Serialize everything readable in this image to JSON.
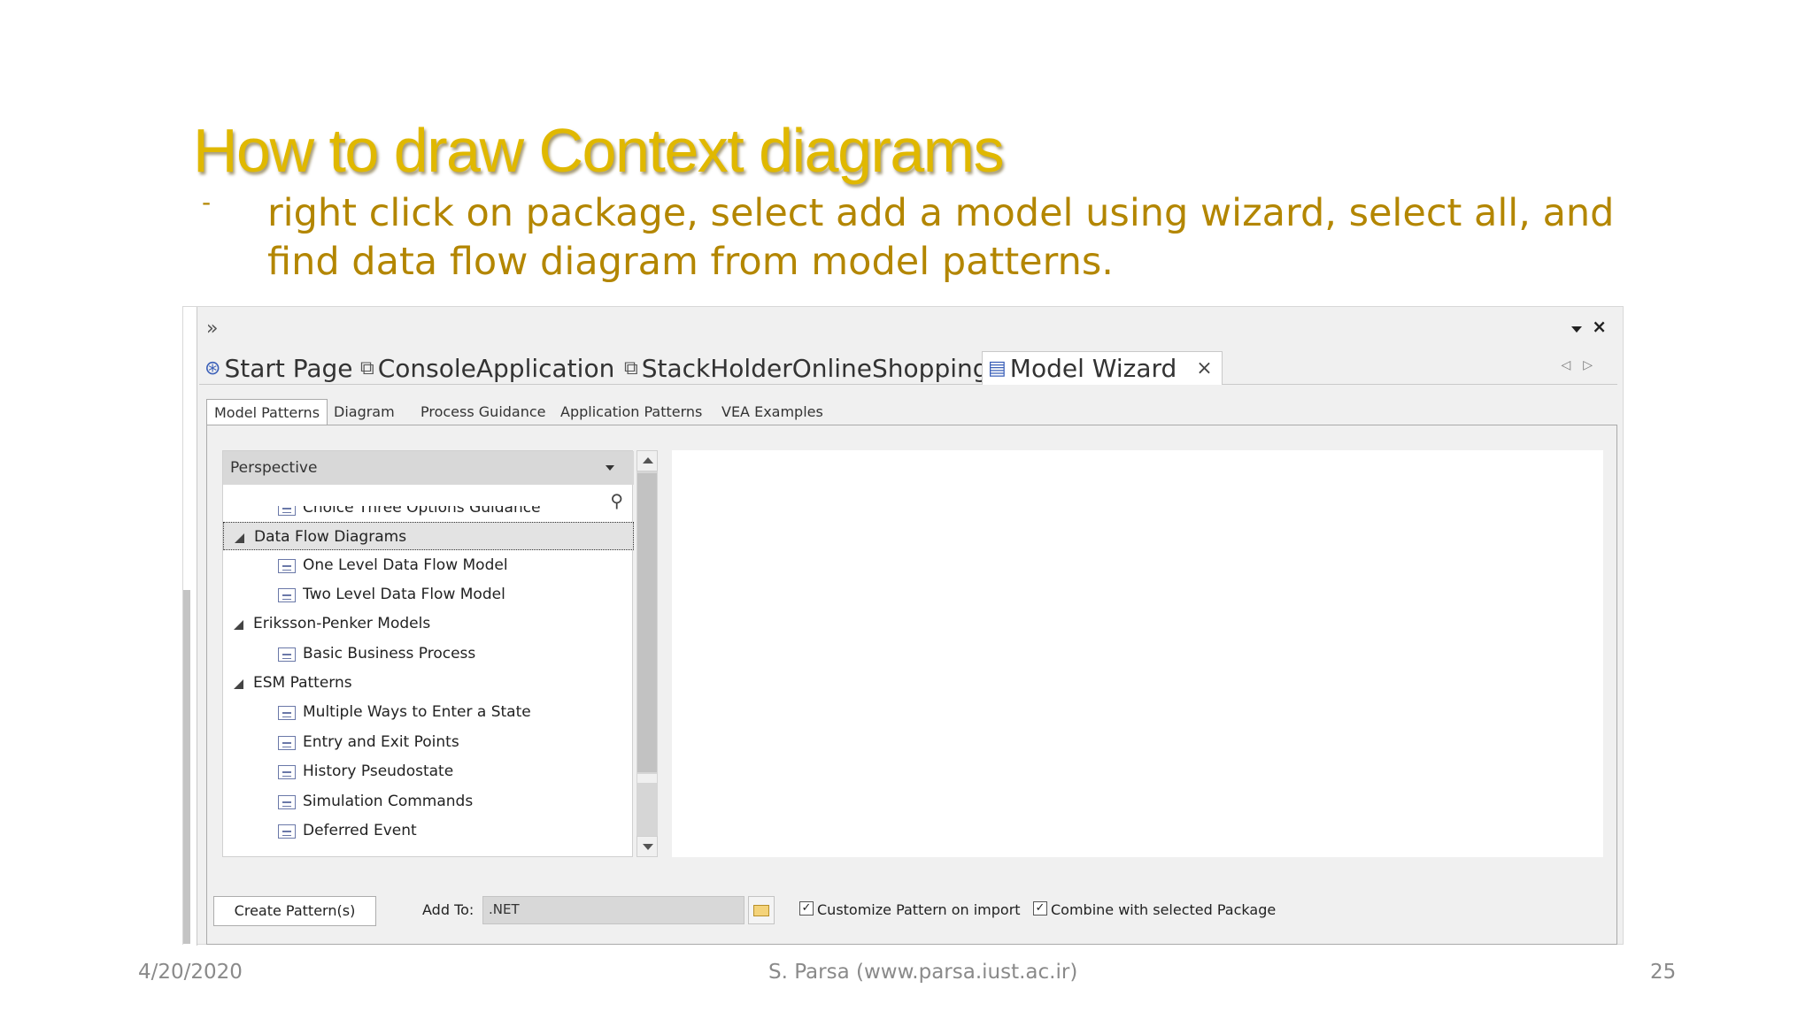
{
  "slide": {
    "title": "How to draw Context diagrams",
    "bullet_marker": "-",
    "body": "right click on package,  select add a model using wizard, select all, and find data flow diagram from model patterns."
  },
  "footer": {
    "date": "4/20/2020",
    "author": "S. Parsa (www.parsa.iust.ac.ir)",
    "page": "25"
  },
  "app": {
    "toolbar": {
      "expand": "»",
      "close": "×"
    },
    "doc_tabs": [
      {
        "label": "Start Page",
        "icon": "start-page-icon",
        "glyph": "⊛"
      },
      {
        "label": "ConsoleApplication",
        "icon": "diagram-icon",
        "glyph": "⧉"
      },
      {
        "label": "StackHolderOnlineShopping",
        "icon": "diagram-icon",
        "glyph": "⧉"
      },
      {
        "label": "Model Wizard",
        "icon": "model-wizard-icon",
        "glyph": "▤",
        "active": true
      }
    ],
    "tab_close": "×",
    "tab_nav": "◁▷",
    "sub_tabs": [
      "Model Patterns",
      "Diagram",
      "Process Guidance",
      "Application Patterns",
      "VEA Examples"
    ],
    "active_sub_tab": "Model Patterns",
    "perspective_label": "Perspective",
    "search_glyph": "🔍",
    "tree": [
      {
        "type": "pattern",
        "label": "Choice Three Options Guidance",
        "partial": true
      },
      {
        "type": "group",
        "label": "Data Flow Diagrams",
        "selected": true
      },
      {
        "type": "pattern",
        "label": "One Level Data Flow Model"
      },
      {
        "type": "pattern",
        "label": "Two Level Data Flow Model"
      },
      {
        "type": "group",
        "label": "Eriksson-Penker Models"
      },
      {
        "type": "pattern",
        "label": "Basic Business Process"
      },
      {
        "type": "group",
        "label": "ESM Patterns"
      },
      {
        "type": "pattern",
        "label": "Multiple Ways to Enter a State"
      },
      {
        "type": "pattern",
        "label": "Entry and Exit Points"
      },
      {
        "type": "pattern",
        "label": "History Pseudostate"
      },
      {
        "type": "pattern",
        "label": "Simulation Commands"
      },
      {
        "type": "pattern",
        "label": "Deferred Event"
      }
    ],
    "bottom": {
      "create_button": "Create Pattern(s)",
      "add_to_label": "Add To:",
      "add_to_value": ".NET",
      "customize_label": "Customize Pattern on import",
      "customize_checked": true,
      "combine_label": "Combine with selected Package",
      "combine_checked": true
    }
  }
}
